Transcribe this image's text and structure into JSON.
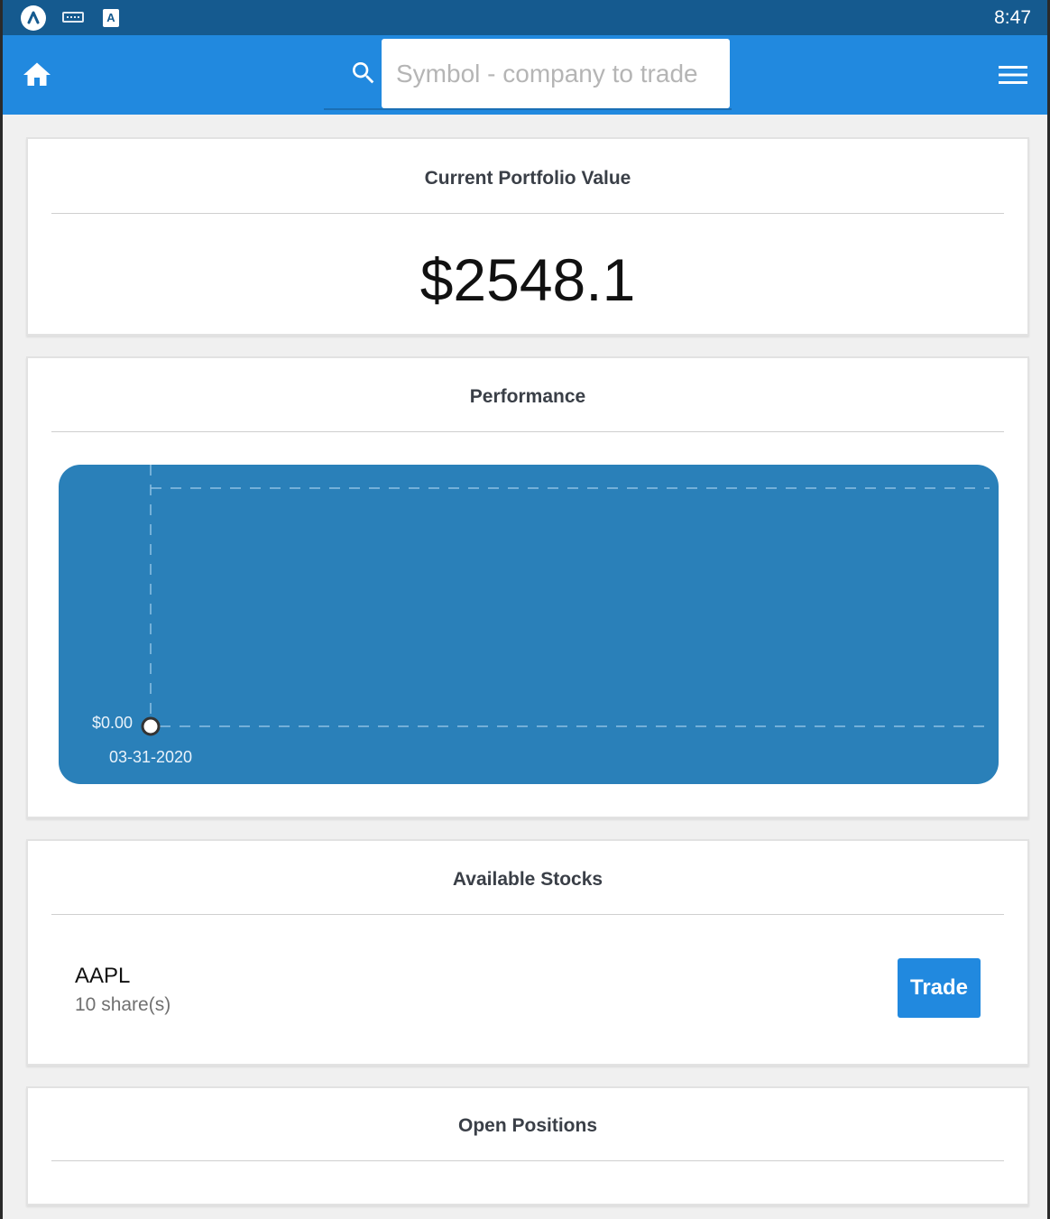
{
  "status_bar": {
    "time": "8:47",
    "icons": [
      "app-launcher-icon",
      "keyboard-icon",
      "a-notification-icon"
    ]
  },
  "app_bar": {
    "home_icon": "home-icon",
    "search": {
      "icon": "search-icon",
      "placeholder": "Symbol - company to trade",
      "value": ""
    },
    "menu_icon": "hamburger-menu-icon"
  },
  "portfolio": {
    "title": "Current Portfolio Value",
    "value": "$2548.1"
  },
  "performance": {
    "title": "Performance"
  },
  "chart_data": {
    "type": "line",
    "title": "",
    "xlabel": "",
    "ylabel": "",
    "x": [
      "03-31-2020"
    ],
    "series": [
      {
        "values": [
          0.0
        ]
      }
    ],
    "tick_labels": {
      "y": [
        "$0.00"
      ],
      "x": [
        "03-31-2020"
      ]
    },
    "grid": true,
    "colors": {
      "background": "#2a80b9",
      "point_fill": "#ffffff",
      "point_stroke": "#333333",
      "grid": "#8cc0e3"
    }
  },
  "stocks": {
    "title": "Available Stocks",
    "items": [
      {
        "symbol": "AAPL",
        "shares": "10 share(s)",
        "action_label": "Trade"
      }
    ]
  },
  "positions": {
    "title": "Open Positions"
  },
  "colors": {
    "status_bar": "#155a8f",
    "app_bar": "#2189df",
    "accent": "#2189df",
    "page_background": "#f0f0f0"
  }
}
